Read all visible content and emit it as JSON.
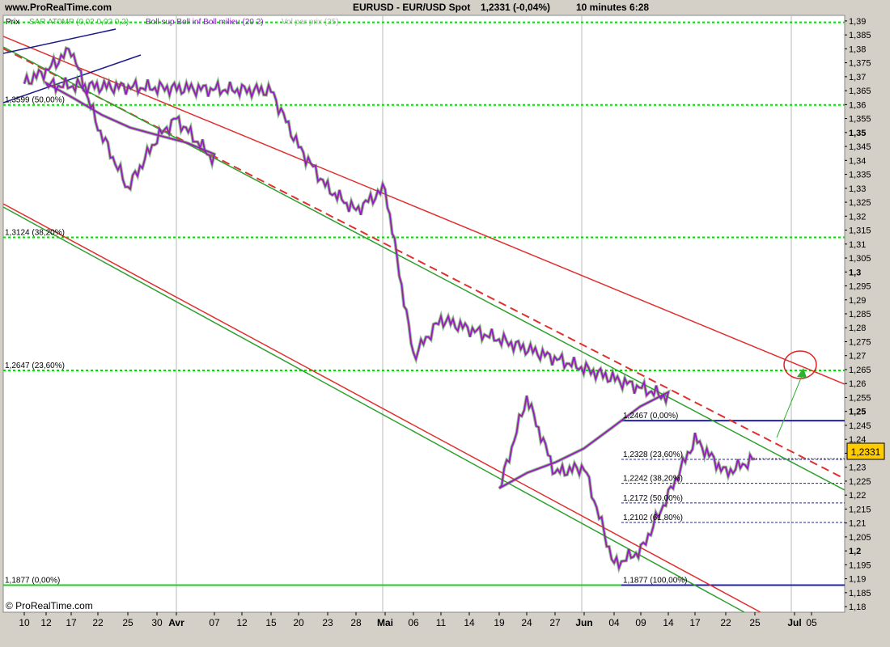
{
  "header": {
    "site": "www.ProRealTime.com",
    "instrument": "EURUSD - EUR/USD Spot",
    "price": "1,2331 (-0,04%)",
    "timeframe": "10 minutes 6:28"
  },
  "legend": {
    "prix": "Prix",
    "sar": "SAR AT0MP (0,02 0,02 0,2)",
    "boll": "Boll sup Boll inf Boll milieu (20 2)",
    "vol": "Vol par prix (25)"
  },
  "footer": "© ProRealTime.com",
  "current_price_label": "1,2331",
  "colors": {
    "background": "#ffffff",
    "frame": "#d4d0c8",
    "channel": "#e03030",
    "trend": "#30a030",
    "fib": "#00dd00",
    "fib_base": "#22cc22",
    "blue_level": "#2020aa",
    "price_line": "#8a1dc7",
    "price_tag": "#ffcc00",
    "annotation_circle": "#e02020",
    "annotation_arrow": "#30b030"
  },
  "chart_data": {
    "type": "line",
    "title": "EURUSD - EUR/USD Spot",
    "x_tick_labels": [
      "10",
      "12",
      "17",
      "22",
      "25",
      "30",
      "Avr",
      "07",
      "12",
      "15",
      "20",
      "23",
      "28",
      "Mai",
      "06",
      "11",
      "14",
      "19",
      "24",
      "27",
      "Jun",
      "04",
      "09",
      "14",
      "17",
      "22",
      "25",
      "Jul",
      "05"
    ],
    "y_tick_labels": [
      "1,39",
      "1,385",
      "1,38",
      "1,375",
      "1,37",
      "1,365",
      "1,36",
      "1,355",
      "1,35",
      "1,345",
      "1,34",
      "1,335",
      "1,33",
      "1,325",
      "1,32",
      "1,315",
      "1,31",
      "1,305",
      "1,3",
      "1,295",
      "1,29",
      "1,285",
      "1,28",
      "1,275",
      "1,27",
      "1,265",
      "1,26",
      "1,255",
      "1,25",
      "1,245",
      "1,24",
      "1,235",
      "1,23",
      "1,225",
      "1,22",
      "1,215",
      "1,21",
      "1,205",
      "1,2",
      "1,195",
      "1,19",
      "1,185",
      "1,18"
    ],
    "ylim": [
      1.178,
      1.392
    ],
    "grid": true,
    "series": [
      {
        "x": [
          "10",
          "12",
          "17",
          "22",
          "25",
          "30",
          "Avr",
          "07",
          "12",
          "15",
          "20",
          "23",
          "28",
          "Mai",
          "06",
          "11",
          "14",
          "19",
          "24",
          "27",
          "Jun",
          "04",
          "09",
          "14",
          "17",
          "22",
          "25"
        ],
        "values": [
          1.368,
          1.372,
          1.38,
          1.352,
          1.33,
          1.348,
          1.355,
          1.34,
          1.367,
          1.365,
          1.345,
          1.33,
          1.322,
          1.33,
          1.27,
          1.283,
          1.255,
          1.222,
          1.255,
          1.228,
          1.23,
          1.195,
          1.2,
          1.22,
          1.24,
          1.228,
          1.233
        ]
      }
    ],
    "fibonacci_left": [
      {
        "label": "1,3599 (50,00%)",
        "value": 1.3599
      },
      {
        "label": "1,3124 (38,20%)",
        "value": 1.3124
      },
      {
        "label": "1,2647 (23,60%)",
        "value": 1.2647
      },
      {
        "label": "1,1877 (0,00%)",
        "value": 1.1877
      }
    ],
    "fibonacci_right": [
      {
        "label": "1,2467 (0,00%)",
        "value": 1.2467
      },
      {
        "label": "1,2328 (23,60%)",
        "value": 1.2328
      },
      {
        "label": "1,2242 (38,20%)",
        "value": 1.2242
      },
      {
        "label": "1,2172 (50,00%)",
        "value": 1.2172
      },
      {
        "label": "1,2102 (61,80%)",
        "value": 1.2102
      },
      {
        "label": "1,1877 (100,00%)",
        "value": 1.1877
      }
    ],
    "current_price": 1.2331
  }
}
